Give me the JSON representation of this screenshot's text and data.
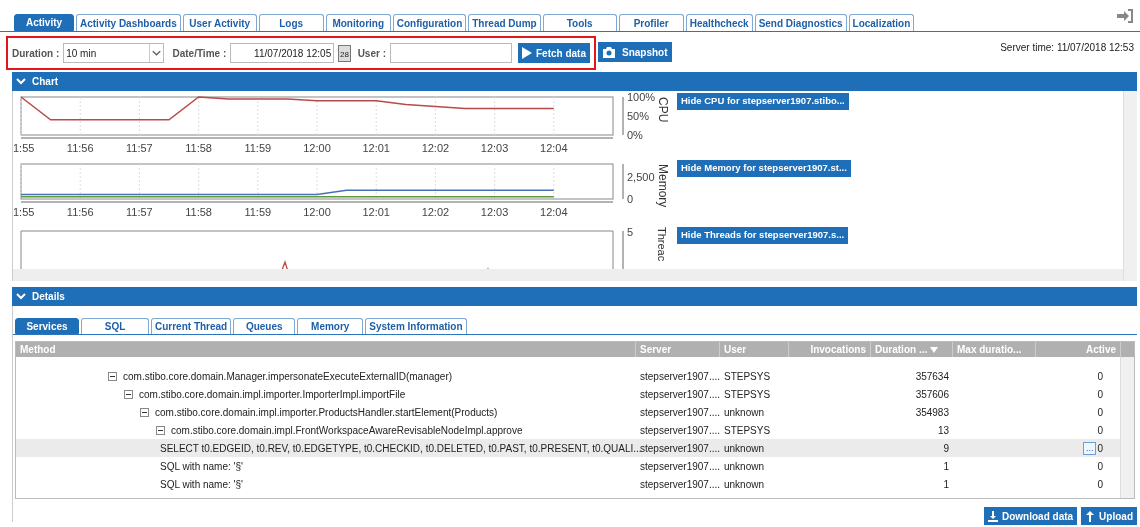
{
  "tabs": [
    {
      "label": "Activity",
      "selected": true
    },
    {
      "label": "Activity Dashboards",
      "selected": false
    },
    {
      "label": "User Activity",
      "selected": false
    },
    {
      "label": "Logs",
      "selected": false
    },
    {
      "label": "Monitoring",
      "selected": false
    },
    {
      "label": "Configuration",
      "selected": false
    },
    {
      "label": "Thread Dump",
      "selected": false
    },
    {
      "label": "Tools",
      "selected": false
    },
    {
      "label": "Profiler",
      "selected": false
    },
    {
      "label": "Healthcheck",
      "selected": false
    },
    {
      "label": "Send Diagnostics",
      "selected": false
    },
    {
      "label": "Localization",
      "selected": false
    }
  ],
  "toolbar": {
    "duration_label": "Duration :",
    "duration_value": "10 min",
    "datetime_label": "Date/Time :",
    "datetime_value": "11/07/2018 12:05",
    "calendar_day": "28",
    "user_label": "User :",
    "fetch_button": "Fetch data",
    "snapshot_button": "Snapshot",
    "server_time": "Server time: 11/07/2018 12:53"
  },
  "chart_section": {
    "title": "Chart",
    "expanded": true,
    "charts": [
      {
        "hide_button": "Hide CPU for stepserver1907.stibo...",
        "chart_data": {
          "type": "line",
          "grid": true,
          "ylabel": "CPU",
          "categories": [
            "1:55",
            null,
            "11:56",
            null,
            "11:57",
            null,
            "11:58",
            null,
            "11:59",
            null,
            "12:00",
            null,
            "12:01",
            null,
            "12:02",
            null,
            "12:03",
            null,
            "12:04"
          ],
          "series": [
            {
              "color": "#b94a4a",
              "values": [
                100,
                40,
                40,
                40,
                40,
                40,
                100,
                95,
                95,
                95,
                90,
                90,
                90,
                80,
                75,
                70,
                70,
                70,
                70
              ]
            }
          ],
          "ylim": [
            0,
            100
          ],
          "yticks": [
            {
              "value": 0,
              "label": "0%"
            },
            {
              "value": 50,
              "label": "50%"
            },
            {
              "value": 100,
              "label": "100%"
            }
          ]
        }
      },
      {
        "hide_button": "Hide Memory for stepserver1907.st...",
        "chart_data": {
          "type": "line",
          "grid": true,
          "ylabel": "Memory",
          "categories": [
            "1:55",
            null,
            "11:56",
            null,
            "11:57",
            null,
            "11:58",
            null,
            "11:59",
            null,
            "12:00",
            null,
            "12:01",
            null,
            "12:02",
            null,
            "12:03",
            null,
            "12:04"
          ],
          "series": [
            {
              "color": "#4a6fb9",
              "values": [
                500,
                500,
                500,
                500,
                500,
                500,
                500,
                500,
                500,
                500,
                500,
                1000,
                1000,
                1000,
                1000,
                1000,
                1000,
                1000,
                1000
              ]
            },
            {
              "color": "#5a9a3a",
              "values": [
                250,
                250,
                250,
                250,
                250,
                250,
                250,
                250,
                250,
                250,
                250,
                250,
                250,
                250,
                250,
                250,
                250,
                250,
                250
              ]
            }
          ],
          "ylim": [
            0,
            4000
          ],
          "yticks": [
            {
              "value": 0,
              "label": "0"
            },
            {
              "value": 2500,
              "label": "2,500"
            }
          ]
        }
      },
      {
        "hide_button": "Hide Threads for stepserver1907.s...",
        "axis_title": "Threac",
        "top_tick": "5"
      }
    ]
  },
  "details_section": {
    "title": "Details",
    "expanded": true,
    "tabs": [
      {
        "label": "Services",
        "selected": true
      },
      {
        "label": "SQL",
        "selected": false
      },
      {
        "label": "Current Thread",
        "selected": false
      },
      {
        "label": "Queues",
        "selected": false
      },
      {
        "label": "Memory",
        "selected": false
      },
      {
        "label": "System Information",
        "selected": false
      }
    ],
    "columns": [
      "Method",
      "Server",
      "User",
      "Invocations",
      "Duration ...",
      "Max duratio...",
      "Active"
    ],
    "rows": [
      {
        "method": "com.stibo.core.domain.Manager.impersonateExecuteExternalID(manager)",
        "server": "stepserver1907....",
        "user": "STEPSYS",
        "duration": "357634",
        "active": "0",
        "expanded": true,
        "selected": false,
        "children": [
          {
            "method": "com.stibo.core.domain.impl.importer.ImporterImpl.importFile",
            "server": "stepserver1907....",
            "user": "STEPSYS",
            "duration": "357606",
            "active": "0",
            "expanded": true,
            "selected": false,
            "children": [
              {
                "method": "com.stibo.core.domain.impl.importer.ProductsHandler.startElement(Products)",
                "server": "stepserver1907....",
                "user": "unknown",
                "duration": "354983",
                "active": "0",
                "expanded": true,
                "selected": false,
                "children": [
                  {
                    "method": "com.stibo.core.domain.impl.FrontWorkspaceAwareRevisableNodeImpl.approve",
                    "server": "stepserver1907....",
                    "user": "STEPSYS",
                    "duration": "13",
                    "active": "0",
                    "expanded": true,
                    "selected": false,
                    "children": [
                      {
                        "method": "SELECT t0.EDGEID, t0.REV, t0.EDGETYPE, t0.CHECKID, t0.DELETED, t0.PAST, t0.PRESENT, t0.QUALI...",
                        "server": "stepserver1907....",
                        "user": "unknown",
                        "duration": "9",
                        "active": "0",
                        "selected": true,
                        "details_button": "..."
                      },
                      {
                        "method": "SQL with name: '§'",
                        "server": "stepserver1907....",
                        "user": "unknown",
                        "duration": "1",
                        "active": "0",
                        "selected": false
                      },
                      {
                        "method": "SQL with name: '§'",
                        "server": "stepserver1907....",
                        "user": "unknown",
                        "duration": "1",
                        "active": "0",
                        "selected": false
                      }
                    ]
                  }
                ]
              }
            ]
          }
        ]
      }
    ],
    "footer_buttons": [
      {
        "kind": "download",
        "label": "Download data"
      },
      {
        "kind": "upload",
        "label": "Upload"
      }
    ]
  }
}
